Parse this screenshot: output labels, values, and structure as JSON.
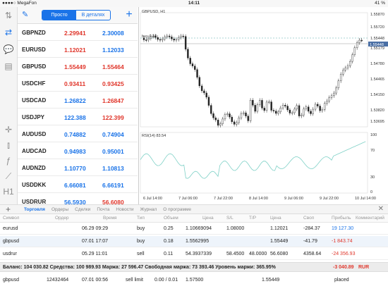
{
  "status_bar": {
    "carrier": "●●●●○ MegaFon",
    "time": "14:11",
    "battery": "41 %"
  },
  "quotes": {
    "mode_simple": "Просто",
    "mode_detailed": "В деталях",
    "rows": [
      {
        "symbol": "GBPNZD",
        "bid": "2.29941",
        "ask": "2.30008",
        "bid_dir": "down",
        "ask_dir": "up"
      },
      {
        "symbol": "EURUSD",
        "bid": "1.12021",
        "ask": "1.12033",
        "bid_dir": "down",
        "ask_dir": "up"
      },
      {
        "symbol": "GBPUSD",
        "bid": "1.55449",
        "ask": "1.55464",
        "bid_dir": "down",
        "ask_dir": "down"
      },
      {
        "symbol": "USDCHF",
        "bid": "0.93411",
        "ask": "0.93425",
        "bid_dir": "down",
        "ask_dir": "down"
      },
      {
        "symbol": "USDCAD",
        "bid": "1.26822",
        "ask": "1.26847",
        "bid_dir": "up",
        "ask_dir": "down"
      },
      {
        "symbol": "USDJPY",
        "bid": "122.388",
        "ask": "122.399",
        "bid_dir": "up",
        "ask_dir": "down"
      },
      {
        "symbol": "AUDUSD",
        "bid": "0.74882",
        "ask": "0.74904",
        "bid_dir": "up",
        "ask_dir": "up"
      },
      {
        "symbol": "AUDCAD",
        "bid": "0.94983",
        "ask": "0.95001",
        "bid_dir": "up",
        "ask_dir": "up"
      },
      {
        "symbol": "AUDNZD",
        "bid": "1.10770",
        "ask": "1.10813",
        "bid_dir": "up",
        "ask_dir": "up"
      },
      {
        "symbol": "USDDKK",
        "bid": "6.66081",
        "ask": "6.66191",
        "bid_dir": "up",
        "ask_dir": "up"
      },
      {
        "symbol": "USDRUR",
        "bid": "56.5930",
        "ask": "56.6080",
        "bid_dir": "up",
        "ask_dir": "down"
      }
    ]
  },
  "chart": {
    "title": "GBPUSD, H1",
    "trade_label": "buy 0.18",
    "indicator_label": "RSI(14) 83.54",
    "price_ticks": [
      "1.55870",
      "1.55720",
      "1.55448",
      "1.55179",
      "1.54780",
      "1.54465",
      "1.54150",
      "1.53820",
      "1.53695"
    ],
    "current_price": "1.55448",
    "rsi_ticks": [
      "100",
      "70",
      "30",
      "0"
    ],
    "time_ticks": [
      "6 Jul 14:00",
      "7 Jul 06:00",
      "7 Jul 22:00",
      "8 Jul 14:00",
      "9 Jul 06:00",
      "9 Jul 22:00",
      "10 Jul 14:00"
    ]
  },
  "bottom_tabs": [
    "Торговля",
    "Ордеры",
    "Сделки",
    "Почта",
    "Новости",
    "Журнал",
    "О программе"
  ],
  "table": {
    "headers": [
      "Символ",
      "Ордер",
      "Время",
      "Тип",
      "Объем",
      "Цена",
      "S/L",
      "T/P",
      "Цена",
      "Своп",
      "Прибыль",
      "Комментарий"
    ],
    "rows": [
      {
        "symbol": "eurusd",
        "order": "",
        "time": "06.29 09:29",
        "type": "buy",
        "volume": "0.25",
        "price": "1.10669094",
        "sl": "1.08000",
        "tp": "",
        "cur_price": "1.12021",
        "swap": "-284.37",
        "profit": "19 127.30",
        "profit_dir": "up",
        "comment": ""
      },
      {
        "symbol": "gbpusd",
        "order": "",
        "time": "07.01 17:07",
        "type": "buy",
        "volume": "0.18",
        "price": "1.5562995",
        "sl": "",
        "tp": "",
        "cur_price": "1.55449",
        "swap": "-41.79",
        "profit": "-1 843.74",
        "profit_dir": "down",
        "comment": ""
      },
      {
        "symbol": "usdrur",
        "order": "",
        "time": "05.29 11:01",
        "type": "sell",
        "volume": "0.11",
        "price": "54.3937339",
        "sl": "58.4500",
        "tp": "48.0000",
        "cur_price": "56.6080",
        "swap": "4358.64",
        "profit": "-24 356.93",
        "profit_dir": "down",
        "comment": ""
      }
    ],
    "balance_line": "Баланс: 104 030.82 Средства: 100 989.93 Маржа: 27 596.47 Свободная маржа: 73 393.46 Уровень маржи: 365.95%",
    "balance_profit": "-3 040.89",
    "balance_currency": "RUR",
    "pending": {
      "symbol": "gbpusd",
      "order": "12432464",
      "time": "07.01 00:56",
      "type": "sell limit",
      "volume": "0.00 / 0.01",
      "price": "1.57500",
      "cur_price": "1.55449",
      "status": "placed"
    }
  },
  "colors": {
    "accent": "#1a73e8",
    "down": "#e0362b",
    "rsi": "#7fd1c7"
  }
}
